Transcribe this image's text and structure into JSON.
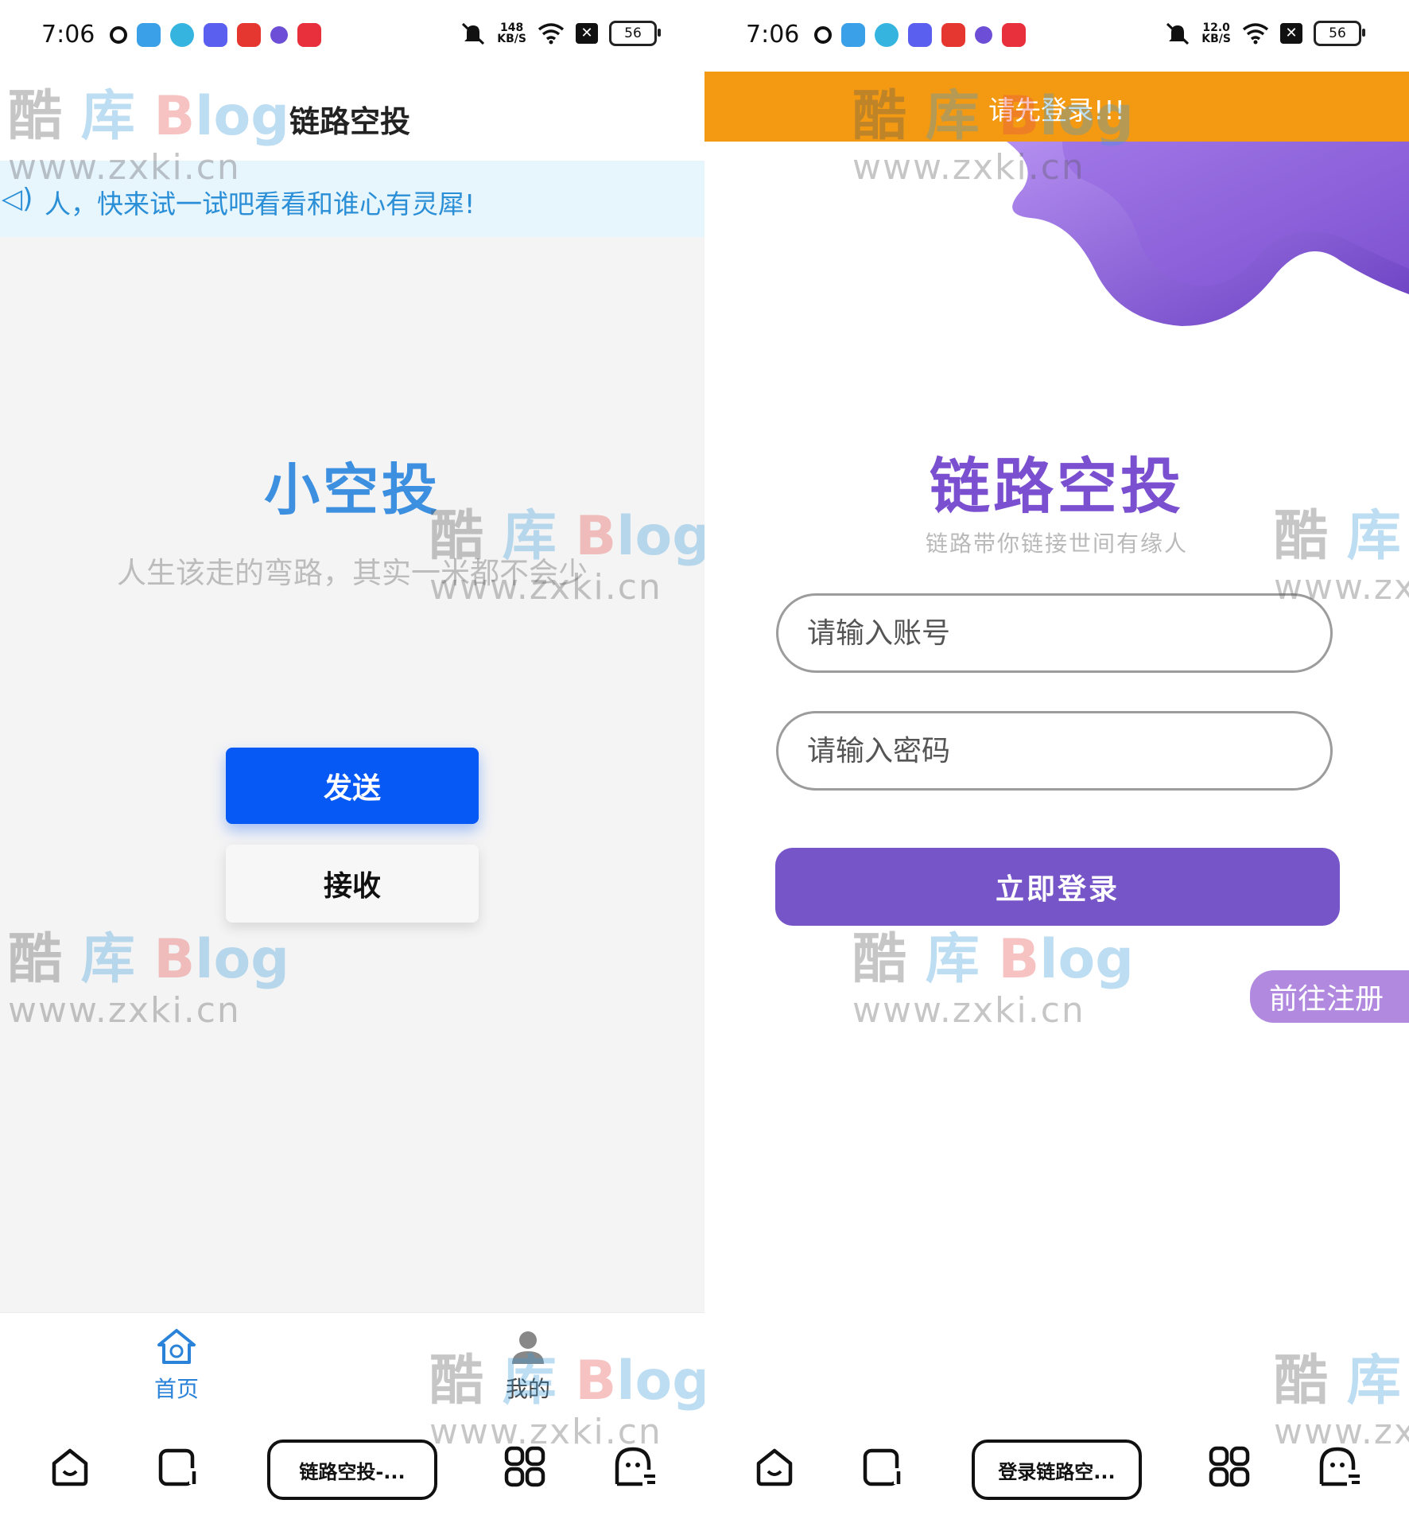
{
  "status_bar": {
    "time": "7:06",
    "left_speed_top": "148",
    "right_speed_top": "12.0",
    "speed_unit": "KB/S",
    "battery": "56"
  },
  "left_screen": {
    "header_title": "链路空投",
    "notice": "人，快来试一试吧看看和谁心有灵犀!",
    "app_name": "小空投",
    "slogan": "人生该走的弯路，其实一米都不会少",
    "send_button": "发送",
    "receive_button": "接收",
    "tabs": [
      {
        "label": "首页",
        "icon": "home-icon"
      },
      {
        "label": "我的",
        "icon": "user-icon"
      }
    ],
    "nav_pill": "链路空投-..."
  },
  "right_screen": {
    "toast": "请先登录!!!",
    "title": "链路空投",
    "subtitle": "链路带你链接世间有缘人",
    "account_placeholder": "请输入账号",
    "password_placeholder": "请输入密码",
    "login_button": "立即登录",
    "register_button": "前往注册",
    "nav_pill": "登录链路空..."
  },
  "watermark": {
    "brand_k": "酷",
    "brand_ku": "库",
    "brand_b": "B",
    "brand_log": "log",
    "url": "www.zxki.cn"
  },
  "colors": {
    "primary_blue": "#0659f5",
    "title_blue": "#3d8fe0",
    "purple": "#7655c8",
    "orange": "#f49a12"
  }
}
